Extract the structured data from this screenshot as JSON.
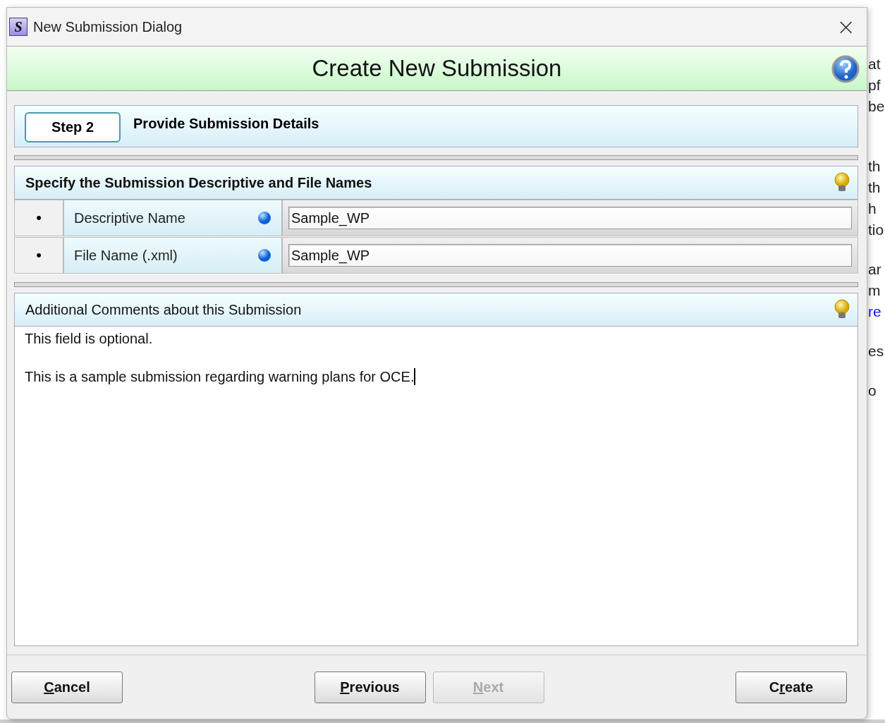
{
  "background_document": {
    "paragraphs": [
      [
        {
          "text": "at",
          "kind": "text"
        },
        {
          "text": "pf",
          "kind": "text"
        },
        {
          "text": "be",
          "kind": "text"
        }
      ],
      [
        {
          "text": "th",
          "kind": "text"
        },
        {
          "text": "th",
          "kind": "text"
        },
        {
          "text": "h",
          "kind": "text"
        },
        {
          "text": "tio",
          "kind": "text"
        }
      ],
      [
        {
          "text": "ar",
          "kind": "text"
        },
        {
          "text": "m",
          "kind": "text"
        },
        {
          "text": "re",
          "kind": "link"
        }
      ],
      [
        {
          "text": "es",
          "kind": "text"
        }
      ],
      [
        {
          "text": "o",
          "kind": "text"
        }
      ]
    ]
  },
  "window": {
    "title": "New Submission Dialog",
    "app_icon": "S",
    "close": "×"
  },
  "banner": {
    "title": "Create New Submission"
  },
  "step": {
    "badge": "Step 2",
    "title": "Provide Submission Details"
  },
  "names_section": {
    "title": "Specify the Submission Descriptive and File Names",
    "rows": [
      {
        "bullet": "•",
        "label": "Descriptive Name",
        "value": "Sample_WP"
      },
      {
        "bullet": "•",
        "label": "File Name (.xml)",
        "value": "Sample_WP"
      }
    ]
  },
  "comments_section": {
    "title": "Additional Comments about this Submission",
    "hint": "This field is optional.",
    "value": "This is a sample submission regarding warning plans for OCE."
  },
  "buttons": [
    {
      "key": "C",
      "after": "ancel",
      "disabled": false
    },
    {
      "key": "P",
      "after": "revious",
      "disabled": false
    },
    {
      "key": "N",
      "after": "ext",
      "disabled": true
    },
    {
      "before": "C",
      "key": "r",
      "after": "eate",
      "disabled": false
    }
  ]
}
